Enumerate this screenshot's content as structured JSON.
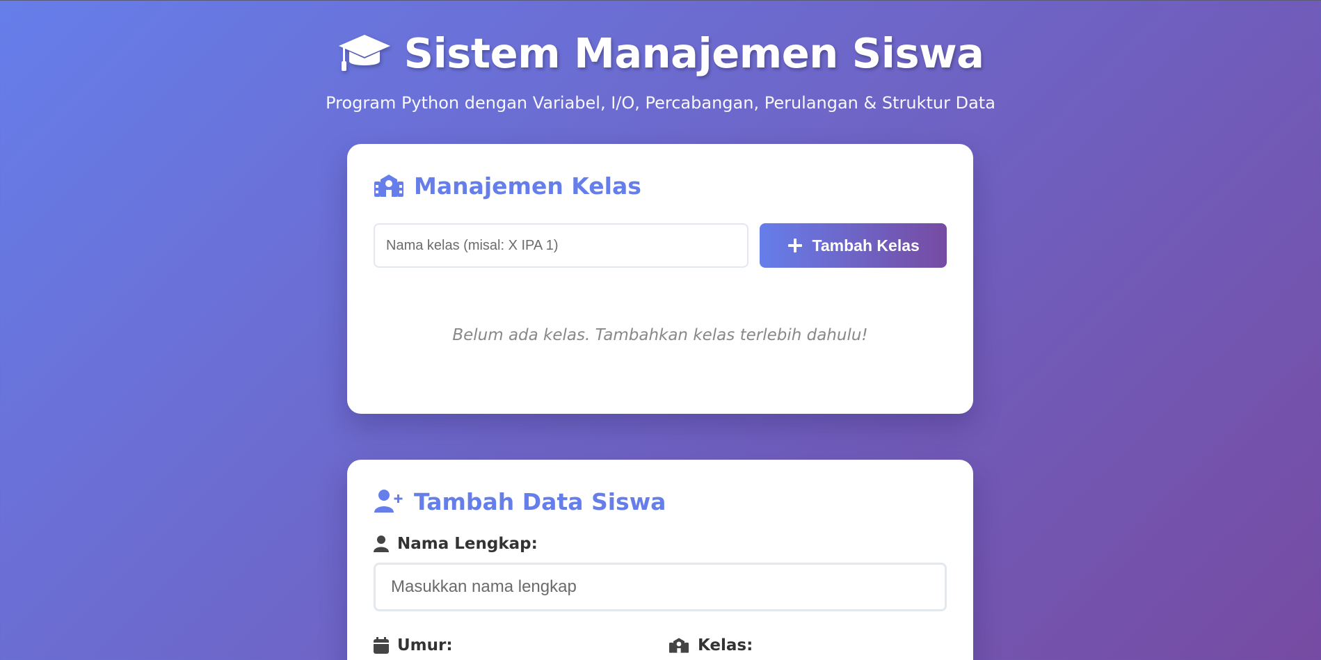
{
  "header": {
    "icon": "graduation-cap-icon",
    "title": "Sistem Manajemen Siswa",
    "subtitle": "Program Python dengan Variabel, I/O, Percabangan, Perulangan & Struktur Data"
  },
  "kelas_card": {
    "icon": "school-icon",
    "title": "Manajemen Kelas",
    "input_placeholder": "Nama kelas (misal: X IPA 1)",
    "input_value": "",
    "add_button_icon": "plus-icon",
    "add_button_label": "Tambah Kelas",
    "empty_message": "Belum ada kelas. Tambahkan kelas terlebih dahulu!"
  },
  "siswa_card": {
    "icon": "user-plus-icon",
    "title": "Tambah Data Siswa",
    "nama_label": "Nama Lengkap:",
    "nama_icon": "user-icon",
    "nama_placeholder": "Masukkan nama lengkap",
    "nama_value": "",
    "umur_label": "Umur:",
    "umur_icon": "calendar-icon",
    "kelas_label": "Kelas:",
    "kelas_icon": "school-icon"
  },
  "colors": {
    "gradient_start": "#667eea",
    "gradient_end": "#764ba2",
    "accent": "#667eea",
    "card_bg": "#ffffff",
    "muted_text": "#888888"
  }
}
